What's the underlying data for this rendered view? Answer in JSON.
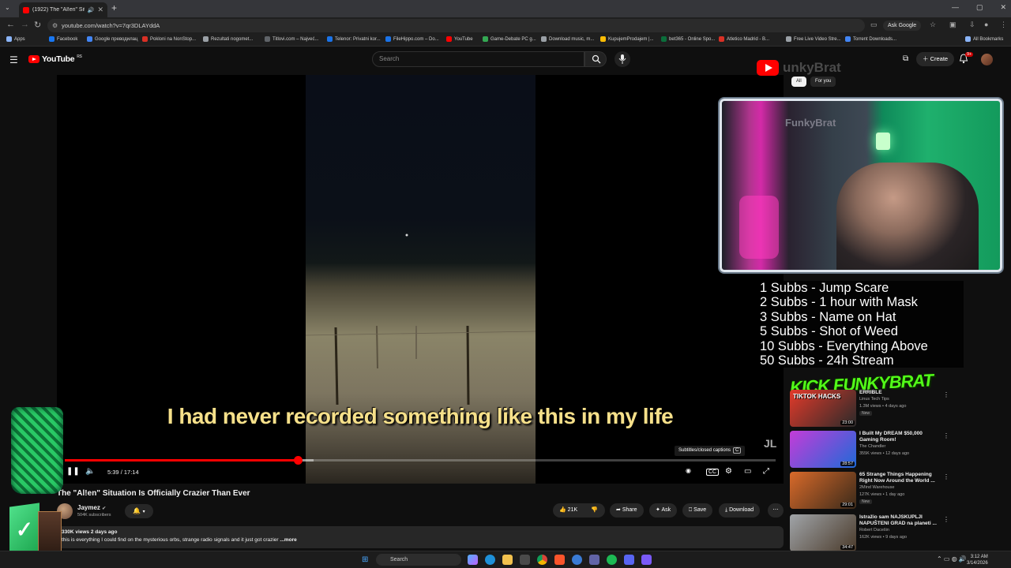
{
  "browser": {
    "tab_title": "(1922) The \"Al!en\" Situatio",
    "url": "youtube.com/watch?v=7qr3DLAYddA",
    "ask_google": "Ask Google",
    "all_bookmarks": "All Bookmarks"
  },
  "bookmarks": [
    {
      "label": "Apps",
      "color": "#8ab4f8"
    },
    {
      "label": "Facebook",
      "color": "#1877f2"
    },
    {
      "label": "Google преводилац",
      "color": "#4285f4"
    },
    {
      "label": "Pokloni na NonStop...",
      "color": "#d93025"
    },
    {
      "label": "Rezultati nogomet...",
      "color": "#9aa0a6"
    },
    {
      "label": "Titlovi.com – Najveć...",
      "color": "#5f6368"
    },
    {
      "label": "Telenor: Privatni kor...",
      "color": "#1a73e8"
    },
    {
      "label": "FileHippo.com – Do...",
      "color": "#1a73e8"
    },
    {
      "label": "YouTube",
      "color": "#ff0000"
    },
    {
      "label": "Game-Debate PC g...",
      "color": "#34a853"
    },
    {
      "label": "Download music, m...",
      "color": "#9aa0a6"
    },
    {
      "label": "KupujemProdajem |...",
      "color": "#fbbc04"
    },
    {
      "label": "bet365 - Online Spo...",
      "color": "#0b6e3b"
    },
    {
      "label": "Atletico Madrid - B...",
      "color": "#d93025"
    },
    {
      "label": "Free Live Video Stre...",
      "color": "#9aa0a6"
    },
    {
      "label": "Torrent Downloads...",
      "color": "#4285f4"
    }
  ],
  "masthead": {
    "logo": "YouTube",
    "region": "RS",
    "search_placeholder": "Search",
    "create": "Create",
    "notifications": "9+"
  },
  "player": {
    "caption": "I had never recorded something like this in my life",
    "watermark": "JL",
    "tooltip": "Subtitles/closed captions",
    "tooltip_key": "C",
    "current_time": "5:39",
    "duration": "17:14",
    "progress": 0.328,
    "buffered": 0.35
  },
  "video": {
    "title": "The \"Al!en\" Situation Is Officially Crazier Than Ever",
    "channel": "Jaymez",
    "subscribers": "504K subscribers",
    "likes": "21K",
    "share": "Share",
    "ask": "Ask",
    "save": "Save",
    "download": "Download",
    "views_date": "330K views  2 days ago",
    "description": "this is everything I could find on the mysterious orbs, strange radio signals and it just got crazier",
    "more": "...more"
  },
  "sidebar": {
    "overlay_brand": "unkyBrat",
    "chips": [
      "All",
      "For you"
    ],
    "webcam_sign": "FunkyBrat",
    "rules": [
      "1 Subbs - Jump Scare",
      "2 Subbs - 1 hour with Mask",
      "3 Subbs - Name on Hat",
      "5 Subbs - Shot of Weed",
      "10 Subbs - Everything Above",
      "50 Subbs - 24h Stream"
    ],
    "kick_banner": "KICK FUNKYBRAT",
    "recommendations": [
      {
        "title": "ERRIBLE",
        "channel": "Linus Tech Tips",
        "meta": "1.3M views • 4 days ago",
        "badge": "New",
        "duration": "23:00",
        "thumb_label": "TIKTOK HACKS",
        "colors": [
          "#e33a2a",
          "#2a2a2a"
        ]
      },
      {
        "title": "I Built My DREAM $50,000 Gaming Room!",
        "channel": "The Chandler",
        "meta": "355K views • 12 days ago",
        "badge": "",
        "duration": "28:57",
        "thumb_label": "",
        "colors": [
          "#c43cd8",
          "#1f6ad8"
        ]
      },
      {
        "title": "65 Strange Things Happening Right Now Around the World ...",
        "channel": "2Mind Warehouse",
        "meta": "127K views • 1 day ago",
        "badge": "New",
        "duration": "29:01",
        "thumb_label": "",
        "colors": [
          "#d96a2a",
          "#3a2a1a"
        ]
      },
      {
        "title": "Istražio sam NAJSKUPLJI NAPUŠTENI GRAD na planeti ...",
        "channel": "Robert Dacešin",
        "meta": "162K views • 9 days ago",
        "badge": "",
        "duration": "34:47",
        "thumb_label": "",
        "colors": [
          "#a0a4a8",
          "#4a3a2a"
        ]
      }
    ]
  },
  "taskbar": {
    "search": "Search",
    "time": "3:12 AM",
    "date": "3/14/2026"
  }
}
